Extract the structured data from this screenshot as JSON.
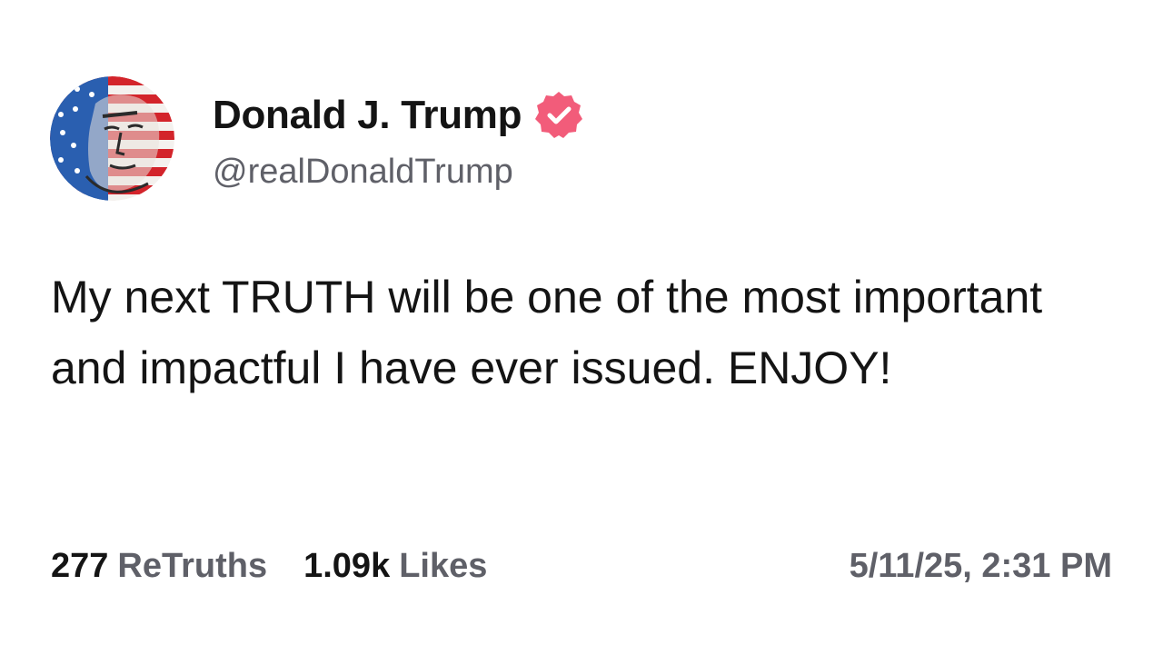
{
  "post": {
    "author": {
      "display_name": "Donald J. Trump",
      "handle": "@realDonaldTrump",
      "verified": true,
      "avatar_icon": "avatar-flag-portrait",
      "verified_icon": "verified-badge-icon"
    },
    "body": "My next TRUTH will be one of the most important and impactful I have ever issued. ENJOY!",
    "stats": {
      "retruths_count": "277",
      "retruths_label": "ReTruths",
      "likes_count": "1.09k",
      "likes_label": "Likes"
    },
    "timestamp": "5/11/25, 2:31 PM"
  },
  "colors": {
    "verified_badge": "#f25c7a",
    "muted_text": "#5f6068",
    "primary_text": "#141414"
  }
}
